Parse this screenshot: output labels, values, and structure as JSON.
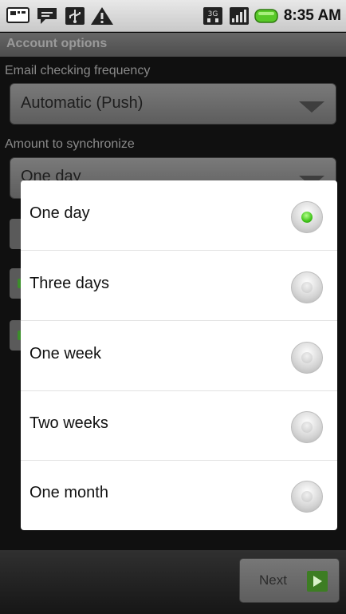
{
  "status_bar": {
    "time": "8:35 AM",
    "icons": [
      "sim-icon",
      "chat-icon",
      "usb-icon",
      "warning-icon",
      "3g-icon",
      "signal-icon",
      "battery-icon"
    ]
  },
  "title": "Account options",
  "settings": {
    "email_frequency_label": "Email checking frequency",
    "email_frequency_value": "Automatic (Push)",
    "sync_amount_label": "Amount to synchronize",
    "sync_amount_value": "One day"
  },
  "dialog": {
    "options": [
      {
        "label": "One day",
        "checked": true
      },
      {
        "label": "Three days",
        "checked": false
      },
      {
        "label": "One week",
        "checked": false
      },
      {
        "label": "Two weeks",
        "checked": false
      },
      {
        "label": "One month",
        "checked": false
      }
    ]
  },
  "footer": {
    "next_label": "Next"
  },
  "colors": {
    "radio_selected": "#41c41a",
    "next_icon": "#3d7d23"
  }
}
